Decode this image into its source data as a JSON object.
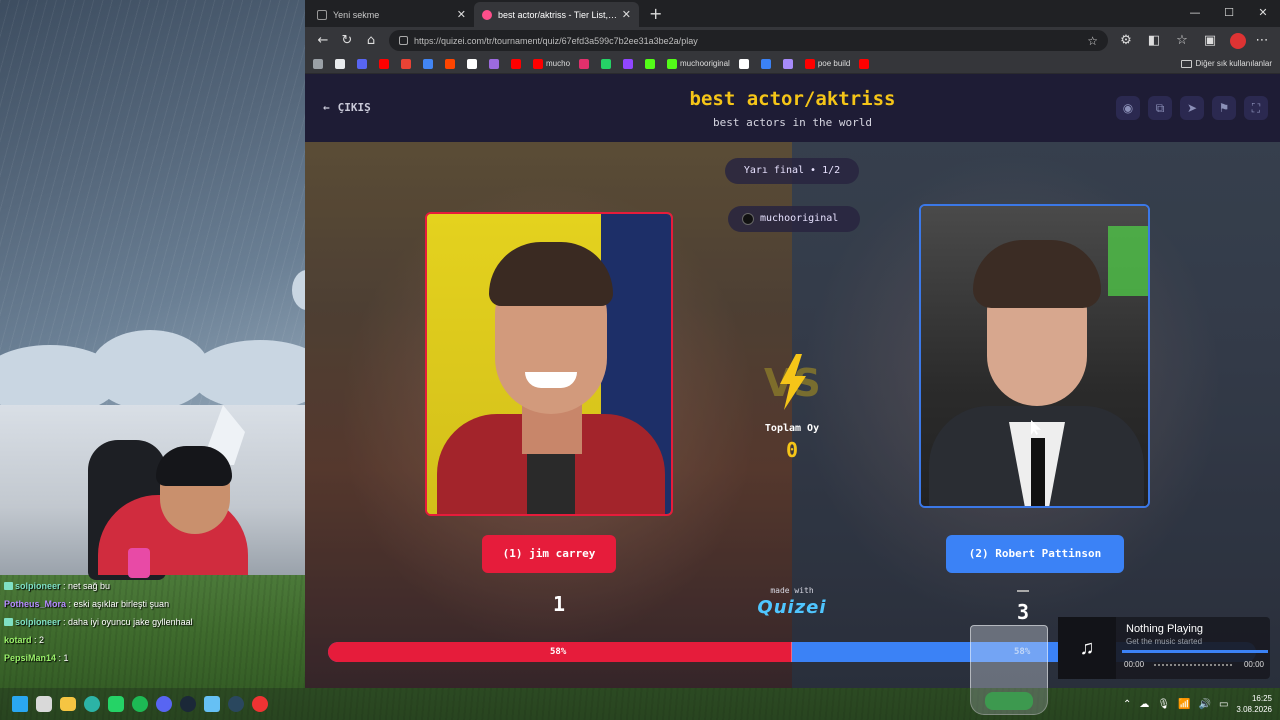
{
  "browser": {
    "tabs": [
      {
        "title": "Yeni sekme",
        "active": false
      },
      {
        "title": "best actor/aktriss - Tier List, Kör Se...",
        "active": true
      }
    ],
    "url": "https://quizei.com/tr/tournament/quiz/67efd3a599c7b2ee31a3be2a/play",
    "bookmarks": [
      {
        "label": "",
        "color": "#9aa0a6"
      },
      {
        "label": "",
        "color": "#e8eaed"
      },
      {
        "label": "",
        "color": "#5865f2"
      },
      {
        "label": "",
        "color": "#ff0000"
      },
      {
        "label": "",
        "color": "#ea4335"
      },
      {
        "label": "",
        "color": "#4285f4"
      },
      {
        "label": "",
        "color": "#ff4500"
      },
      {
        "label": "",
        "color": "#ffffff"
      },
      {
        "label": "",
        "color": "#9c6ade"
      },
      {
        "label": "",
        "color": "#ff0000"
      },
      {
        "label": "mucho",
        "color": "#ff0000"
      },
      {
        "label": "",
        "color": "#e1306c"
      },
      {
        "label": "",
        "color": "#25d366"
      },
      {
        "label": "",
        "color": "#9146ff"
      },
      {
        "label": "",
        "color": "#53fc18"
      },
      {
        "label": "muchooriginal",
        "color": "#53fc18"
      },
      {
        "label": "",
        "color": "#ffffff"
      },
      {
        "label": "",
        "color": "#3b82f6"
      },
      {
        "label": "",
        "color": "#a78bfa"
      },
      {
        "label": "poe build",
        "color": "#ff0000"
      },
      {
        "label": "",
        "color": "#ff0000"
      }
    ],
    "other_bookmarks": "Diğer sık kullanılanlar"
  },
  "quiz": {
    "exit_label": "ÇIKIŞ",
    "title": "best actor/aktriss",
    "subtitle": "best actors in the world",
    "stage": "Yarı final • 1/2",
    "creator": "muchooriginal",
    "total_votes_label": "Toplam Oy",
    "total_votes": 0,
    "left": {
      "button": "(1) jim carrey",
      "count": "1",
      "color": "#e61c3b"
    },
    "right": {
      "button": "(2) Robert Pattinson",
      "count": "3",
      "color": "#3b82f6"
    },
    "made_with": "made with",
    "brand": "Quizei",
    "bar": {
      "left_pct_label": "58%",
      "right_pct_label": "58%",
      "left_fraction": 0.5
    }
  },
  "chat": [
    {
      "user": "solpioneer",
      "msg": "net sağ bu",
      "color": "#7fe0c4",
      "badge": true
    },
    {
      "user": "Potheus_Mora",
      "msg": "eski aşıklar birleşti şuan",
      "color": "#b58cff",
      "badge": false
    },
    {
      "user": "solpioneer",
      "msg": "daha iyi oyuncu jake gyllenhaal",
      "color": "#7fe0c4",
      "badge": true
    },
    {
      "user": "kotard",
      "msg": "2",
      "color": "#9af06a",
      "badge": false
    },
    {
      "user": "PepsiMan14",
      "msg": "1",
      "color": "#9af06a",
      "badge": false
    }
  ],
  "music": {
    "title": "Nothing Playing",
    "subtitle": "Get the music started",
    "time_start": "00:00",
    "time_end": "00:00"
  },
  "taskbar": {
    "time": "16:25",
    "date": "3.08.2026"
  }
}
